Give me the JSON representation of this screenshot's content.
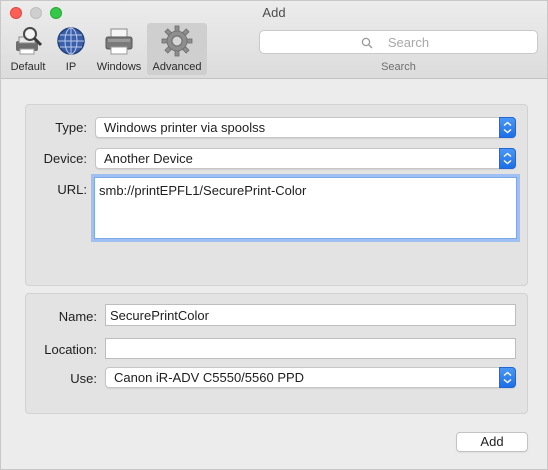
{
  "window": {
    "title": "Add"
  },
  "toolbar": {
    "items": [
      {
        "label": "Default",
        "icon": "default-printer-icon"
      },
      {
        "label": "IP",
        "icon": "globe-icon"
      },
      {
        "label": "Windows",
        "icon": "windows-printer-icon"
      },
      {
        "label": "Advanced",
        "icon": "gear-icon",
        "selected": true
      }
    ]
  },
  "search": {
    "placeholder": "Search",
    "value": "",
    "label": "Search"
  },
  "connection": {
    "type_label": "Type:",
    "type_value": "Windows printer via spoolss",
    "device_label": "Device:",
    "device_value": "Another Device",
    "url_label": "URL:",
    "url_value": "smb://printEPFL1/SecurePrint-Color"
  },
  "printer": {
    "name_label": "Name:",
    "name_value": "SecurePrintColor",
    "location_label": "Location:",
    "location_value": "",
    "use_label": "Use:",
    "use_value": "Canon iR-ADV C5550/5560 PPD"
  },
  "actions": {
    "add_label": "Add"
  },
  "colors": {
    "accent": "#1c6fe8",
    "focus_ring": "#9fc0f3",
    "close": "#fd5f57",
    "zoom": "#34c84a"
  }
}
